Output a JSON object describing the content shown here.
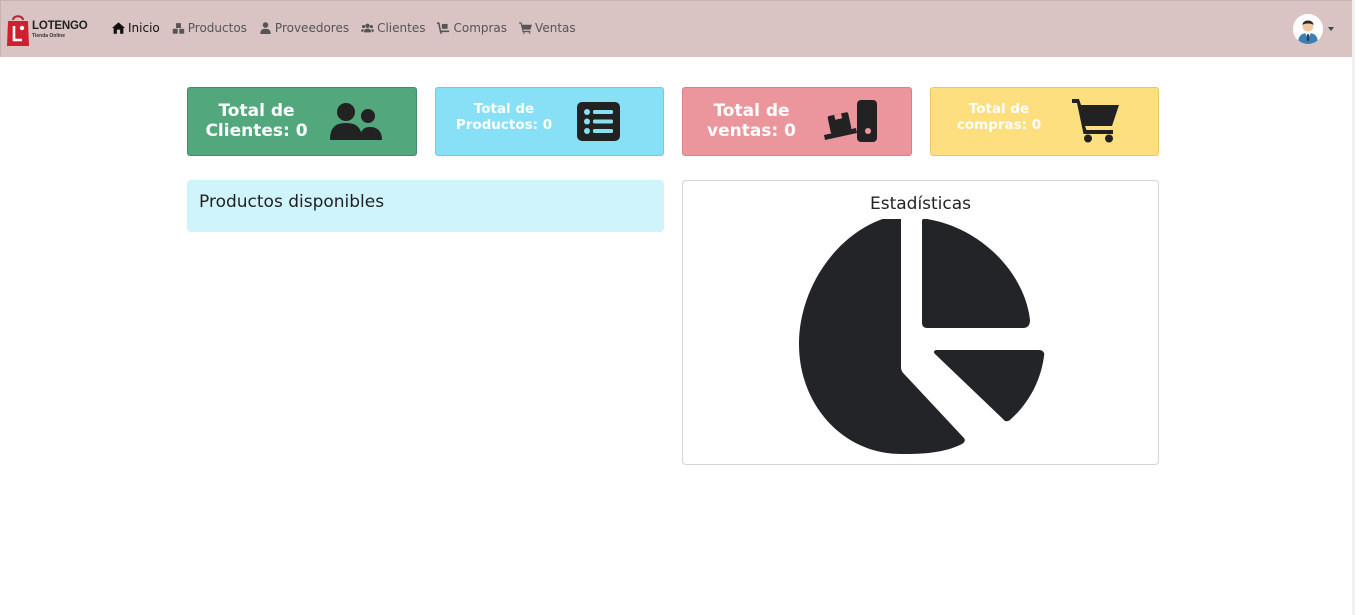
{
  "brand": {
    "name": "LOTENGO",
    "tagline": "Tienda Online",
    "color": "#d0202f"
  },
  "nav": [
    {
      "label": "Inicio",
      "icon": "home-icon",
      "active": true
    },
    {
      "label": "Productos",
      "icon": "boxes-icon",
      "active": false
    },
    {
      "label": "Proveedores",
      "icon": "user-tie-icon",
      "active": false
    },
    {
      "label": "Clientes",
      "icon": "users-icon",
      "active": false
    },
    {
      "label": "Compras",
      "icon": "dolly-icon",
      "active": false
    },
    {
      "label": "Ventas",
      "icon": "cart-icon",
      "active": false
    }
  ],
  "user": {
    "avatar": "user-avatar"
  },
  "cards": [
    {
      "line1": "Total de",
      "line2": "Clientes: 0",
      "icon": "users-icon",
      "color": "#52a77d"
    },
    {
      "line1": "Total de",
      "line2": "Productos: 0",
      "icon": "list-icon",
      "color": "#87e0f5"
    },
    {
      "line1": "Total de",
      "line2": "ventas: 0",
      "icon": "dolly-icon",
      "color": "#eb969d"
    },
    {
      "line1": "Total de",
      "line2": "compras: 0",
      "icon": "cart-icon",
      "color": "#fedf7f"
    }
  ],
  "panels": {
    "products_title": "Productos disponibles",
    "stats_title": "Estadísticas",
    "stats_icon": "pie-chart-icon"
  }
}
